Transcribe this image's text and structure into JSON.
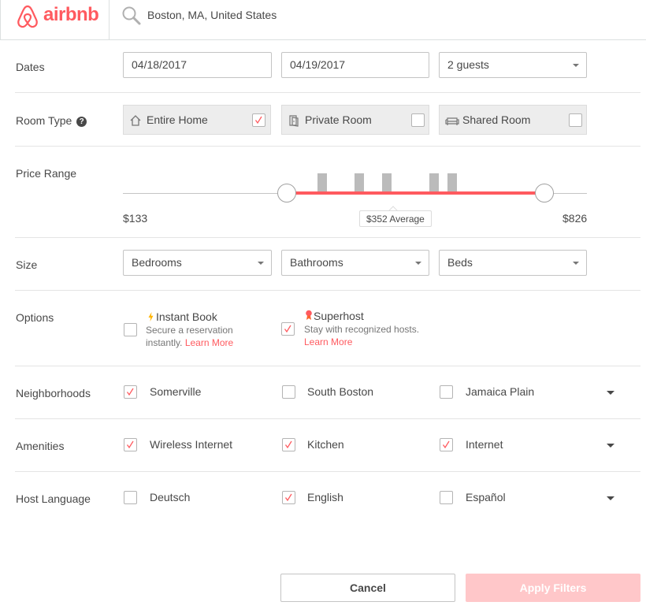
{
  "header": {
    "logo_text": "airbnb",
    "location": "Boston, MA, United States"
  },
  "dates": {
    "label": "Dates",
    "checkin": "04/18/2017",
    "checkout": "04/19/2017",
    "guests": "2 guests"
  },
  "room_type": {
    "label": "Room Type",
    "help": "?",
    "options": [
      {
        "label": "Entire Home",
        "checked": true,
        "icon": "home-icon"
      },
      {
        "label": "Private Room",
        "checked": false,
        "icon": "door-icon"
      },
      {
        "label": "Shared Room",
        "checked": false,
        "icon": "couch-icon"
      }
    ]
  },
  "price_range": {
    "label": "Price Range",
    "min_label": "$133",
    "max_label": "$826",
    "average_label": "$352 Average"
  },
  "size": {
    "label": "Size",
    "bedrooms": "Bedrooms",
    "bathrooms": "Bathrooms",
    "beds": "Beds"
  },
  "options": {
    "label": "Options",
    "instant_book": {
      "title": "Instant Book",
      "desc1": "Secure a reservation",
      "desc2": "instantly.",
      "link": "Learn More",
      "checked": false
    },
    "superhost": {
      "title": "Superhost",
      "desc1": "Stay with recognized hosts.",
      "link": "Learn More",
      "checked": true
    }
  },
  "neighborhoods": {
    "label": "Neighborhoods",
    "items": [
      {
        "label": "Somerville",
        "checked": true
      },
      {
        "label": "South Boston",
        "checked": false
      },
      {
        "label": "Jamaica Plain",
        "checked": false
      }
    ]
  },
  "amenities": {
    "label": "Amenities",
    "items": [
      {
        "label": "Wireless Internet",
        "checked": true
      },
      {
        "label": "Kitchen",
        "checked": true
      },
      {
        "label": "Internet",
        "checked": true
      }
    ]
  },
  "host_language": {
    "label": "Host Language",
    "items": [
      {
        "label": "Deutsch",
        "checked": false
      },
      {
        "label": "English",
        "checked": true
      },
      {
        "label": "Español",
        "checked": false
      }
    ]
  },
  "footer": {
    "cancel": "Cancel",
    "apply": "Apply Filters"
  },
  "colors": {
    "brand": "#ff5a5f",
    "apply_disabled": "#ffc7c9"
  }
}
